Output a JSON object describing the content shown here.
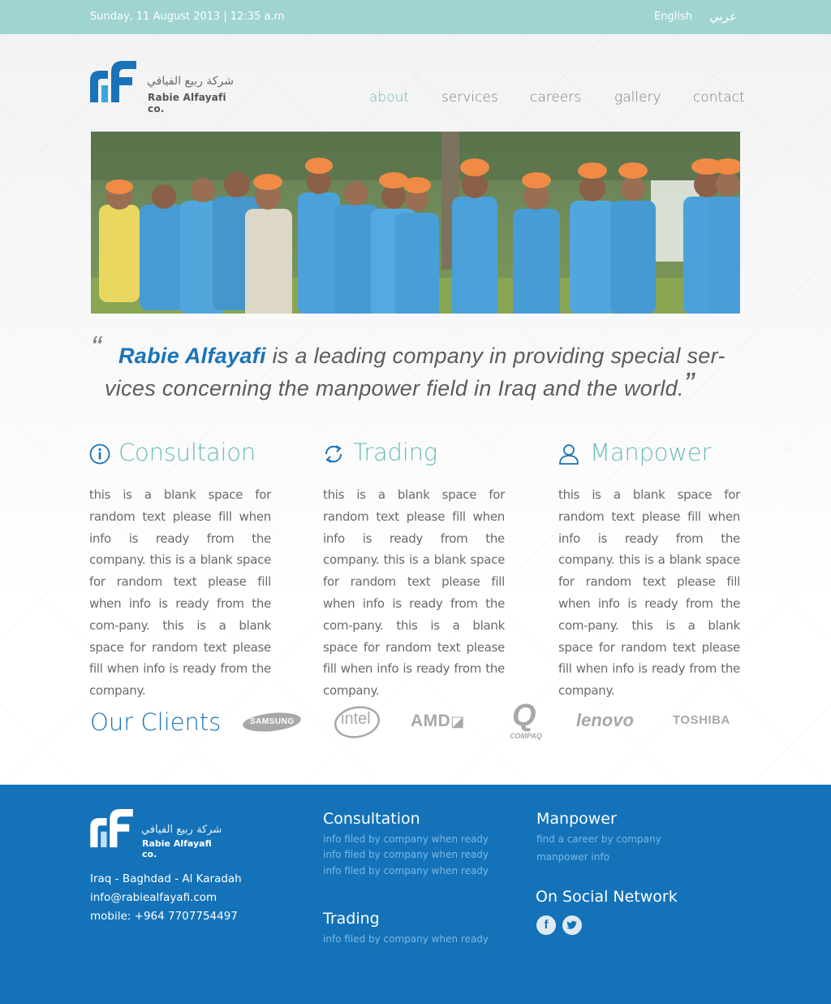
{
  "topbar": {
    "date": "Sunday, 11 August 2013 |  12:35 a.m",
    "lang_en": "English",
    "lang_ar": "عربي"
  },
  "header": {
    "logo_ar": "شركة ربيع الفيافي",
    "logo_en": "Rabie Alfayafi co.",
    "nav": [
      "about",
      "services",
      "careers",
      "gallery",
      "contact"
    ],
    "active": "about"
  },
  "quote": {
    "brand": "Rabie Alfayafi",
    "line1_rest": " is a leading company in providing special ser-",
    "line2": "vices concerning the manpower field in Iraq and the world.",
    "open_mark": "“",
    "close_mark": "”"
  },
  "features": [
    {
      "title": "Consultaion",
      "icon": "info-icon",
      "text": "this is a blank space for random text please fill when info is ready from the company. this is a blank space for random text please fill when info is ready from the com-pany. this is a blank space for random text please fill when info is ready from the company."
    },
    {
      "title": "Trading",
      "icon": "refresh-icon",
      "text": "this is a blank space for random text please fill when info is ready from the company. this is a blank space for random text please fill when info is ready from the com-pany. this is a blank space for random text please fill when info is ready from the company."
    },
    {
      "title": "Manpower",
      "icon": "user-icon",
      "text": "this is a blank space for random text please fill when info is ready from the company. this is a blank space for random text please fill when info is ready from the com-pany. this is a blank space for random text please fill when info is ready from the company."
    }
  ],
  "clients": {
    "title": "Our Clients",
    "logos": [
      "SAMSUNG",
      "intel",
      "AMD",
      "COMPAQ",
      "lenovo",
      "TOSHIBA"
    ]
  },
  "footer": {
    "logo_ar": "شركة ربيع الفيافي",
    "logo_en": "Rabie Alfayafi co.",
    "address": "Iraq - Baghdad - Al Karadah",
    "email": "info@rabiealfayafi.com",
    "mobile": "mobile: +964 7707754497",
    "consultation_title": "Consultation",
    "consultation_items": [
      "info filed by company when ready",
      "info filed by company when ready",
      "info filed by company when ready"
    ],
    "trading_title": "Trading",
    "trading_items": [
      "info filed by company when ready"
    ],
    "manpower_title": "Manpower",
    "manpower_items": [
      "find a career by company",
      "manpower info"
    ],
    "social_title": "On Social Network",
    "social": [
      "facebook-icon",
      "twitter-icon"
    ]
  },
  "colors": {
    "topbar": "#9fd4d1",
    "accent": "#6bbdb7",
    "brand_blue": "#1a73b8",
    "footer": "#1372b8"
  }
}
